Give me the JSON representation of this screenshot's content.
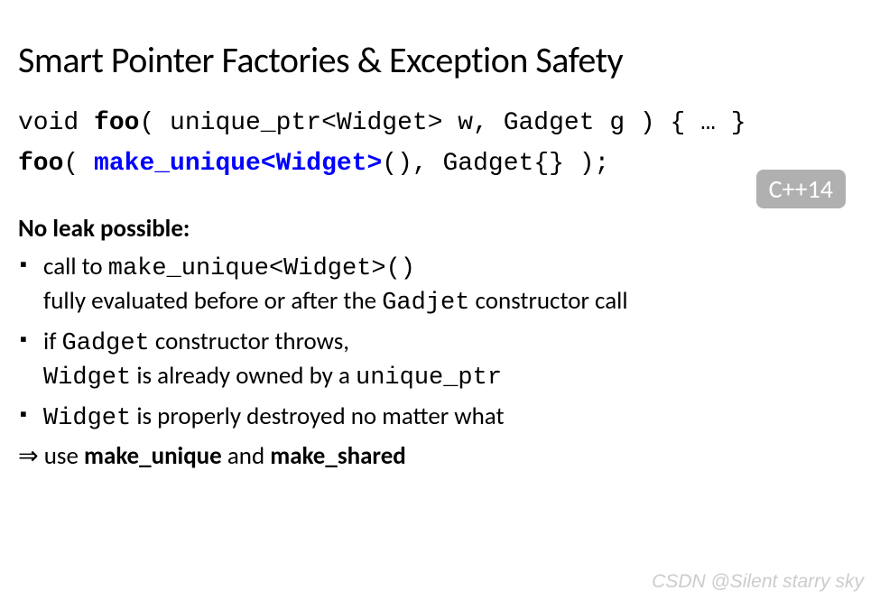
{
  "title": "Smart Pointer Factories & Exception Safety",
  "code": {
    "line1_prefix": "void ",
    "line1_bold": "foo",
    "line1_suffix": "( unique_ptr<Widget> w, Gadget g ) { … }",
    "line2_bold": "foo",
    "line2_paren": "( ",
    "line2_blue": "make_unique<Widget>",
    "line2_suffix": "(), Gadget{} );"
  },
  "badge": "C++14",
  "subheading": "No leak possible:",
  "bullets": [
    {
      "text1": "call to ",
      "mono1": "make_unique<Widget>()",
      "break": true,
      "text2": "fully evaluated before or after the ",
      "mono2": "Gadjet",
      "text3": " constructor call"
    },
    {
      "text1": "if ",
      "mono1": "Gadget",
      "text2": " constructor throws,",
      "break": true,
      "mono2": "Widget",
      "text3": " is already owned by a ",
      "mono3": "unique_ptr"
    },
    {
      "mono1": "Widget",
      "text1": " is properly destroyed no matter what"
    }
  ],
  "conclusion": {
    "arrow": "⇒ ",
    "text1": "use ",
    "bold1": "make_unique",
    "text2": " and ",
    "bold2": "make_shared"
  },
  "watermark": "CSDN @Silent starry sky"
}
